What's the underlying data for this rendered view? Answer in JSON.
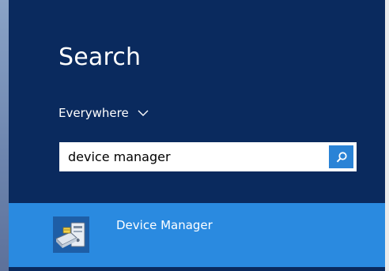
{
  "charm": {
    "title": "Search",
    "scope": {
      "selected": "Everywhere",
      "icon": "chevron-down-icon"
    },
    "search": {
      "value": "device manager",
      "placeholder": "",
      "button_icon": "search-icon"
    },
    "results": [
      {
        "label": "Device Manager",
        "icon": "device-manager-app-icon"
      }
    ]
  },
  "colors": {
    "panel_background": "#0a2a5e",
    "result_highlight": "#2a8ae0",
    "search_button": "#2a83d6",
    "text": "#ffffff"
  }
}
